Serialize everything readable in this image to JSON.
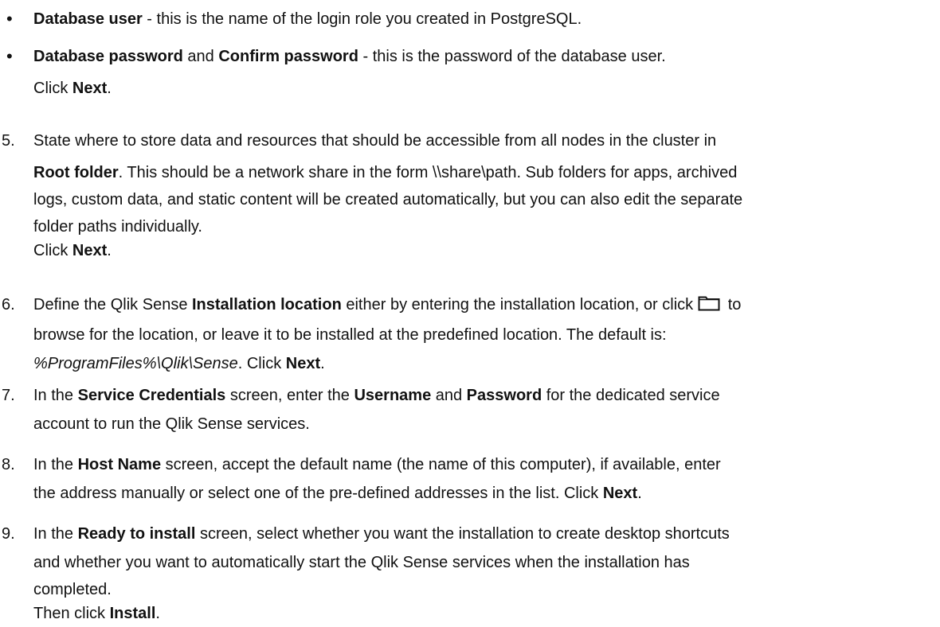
{
  "bullets": [
    {
      "parts": [
        {
          "bold": "Database user"
        },
        {
          "text": " - this is the name of the login role you created in PostgreSQL."
        }
      ]
    },
    {
      "parts": [
        {
          "bold": "Database password"
        },
        {
          "text": " and "
        },
        {
          "bold": "Confirm password"
        },
        {
          "text": " - this is the password of the database user."
        }
      ],
      "followup": {
        "text": "Click ",
        "bold": "Next",
        "end": "."
      }
    }
  ],
  "steps": [
    {
      "num": "5.",
      "lines": [
        [
          {
            "text": "State where to store data and resources that should be accessible from all nodes in the cluster in"
          }
        ],
        [
          {
            "bold": "Root folder"
          },
          {
            "text": ". This should be a network share in the form \\\\share\\path. Sub folders for apps, archived"
          }
        ],
        [
          {
            "text": "logs, custom data, and static content will be created automatically, but you can also edit the separate"
          }
        ],
        [
          {
            "text": "folder paths individually."
          }
        ],
        [
          {
            "text": "Click "
          },
          {
            "bold": "Next"
          },
          {
            "text": "."
          }
        ]
      ]
    },
    {
      "num": "6.",
      "lines": [
        [
          {
            "text": "Define the Qlik Sense "
          },
          {
            "bold": "Installation location"
          },
          {
            "text": " either by entering the installation location, or click"
          },
          {
            "icon": "folder-icon"
          },
          {
            "text": " to"
          }
        ],
        [
          {
            "text": "browse for the location, or leave it to be installed at the predefined location. The default is:"
          }
        ],
        [
          {
            "italic": "%ProgramFiles%\\Qlik\\Sense"
          },
          {
            "text": ". Click "
          },
          {
            "bold": "Next"
          },
          {
            "text": "."
          }
        ]
      ]
    },
    {
      "num": "7.",
      "lines": [
        [
          {
            "text": "In the "
          },
          {
            "bold": "Service Credentials"
          },
          {
            "text": " screen, enter the "
          },
          {
            "bold": "Username"
          },
          {
            "text": " and "
          },
          {
            "bold": "Password"
          },
          {
            "text": " for the dedicated service"
          }
        ],
        [
          {
            "text": "account to run the Qlik Sense services."
          }
        ]
      ]
    },
    {
      "num": "8.",
      "lines": [
        [
          {
            "text": "In the "
          },
          {
            "bold": "Host Name"
          },
          {
            "text": " screen, accept the default name (the name of this computer), if available, enter"
          }
        ],
        [
          {
            "text": "the address manually or select one of the pre-defined addresses in the list. Click "
          },
          {
            "bold": "Next"
          },
          {
            "text": "."
          }
        ]
      ]
    },
    {
      "num": "9.",
      "lines": [
        [
          {
            "text": "In the "
          },
          {
            "bold": "Ready to install"
          },
          {
            "text": " screen, select whether you want the installation to create desktop shortcuts"
          }
        ],
        [
          {
            "text": "and whether you want to automatically start the Qlik Sense services when the installation has"
          }
        ],
        [
          {
            "text": "completed."
          }
        ],
        [
          {
            "text": "Then click "
          },
          {
            "bold": "Install"
          },
          {
            "text": "."
          }
        ]
      ]
    }
  ]
}
